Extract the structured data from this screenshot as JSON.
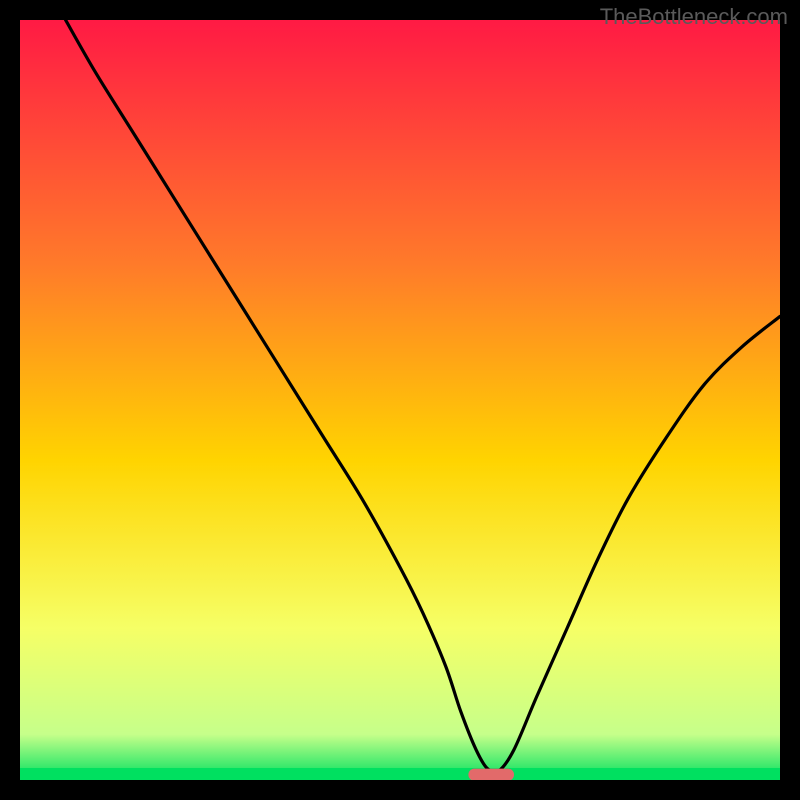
{
  "watermark": "TheBottleneck.com",
  "chart_data": {
    "type": "line",
    "title": "",
    "xlabel": "",
    "ylabel": "",
    "xlim": [
      0,
      100
    ],
    "ylim": [
      0,
      100
    ],
    "gradient_colors": {
      "top": "#ff1a44",
      "upper_mid": "#ff7a2a",
      "mid": "#ffd400",
      "lower_mid": "#f6ff66",
      "band": "#c6ff8a",
      "bottom": "#00e060"
    },
    "curve": {
      "name": "bottleneck-curve",
      "stroke": "#000000",
      "x": [
        6,
        10,
        15,
        20,
        25,
        30,
        35,
        40,
        45,
        50,
        53,
        56,
        58,
        60,
        61.5,
        63,
        65,
        68,
        72,
        76,
        80,
        85,
        90,
        95,
        100
      ],
      "y": [
        100,
        93,
        85,
        77,
        69,
        61,
        53,
        45,
        37,
        28,
        22,
        15,
        9,
        4,
        1.5,
        1.2,
        4,
        11,
        20,
        29,
        37,
        45,
        52,
        57,
        61
      ]
    },
    "marker": {
      "name": "bottleneck-marker",
      "color": "#e26a6a",
      "x_center": 62,
      "y": 0.7,
      "width": 6,
      "height": 1.6
    }
  }
}
